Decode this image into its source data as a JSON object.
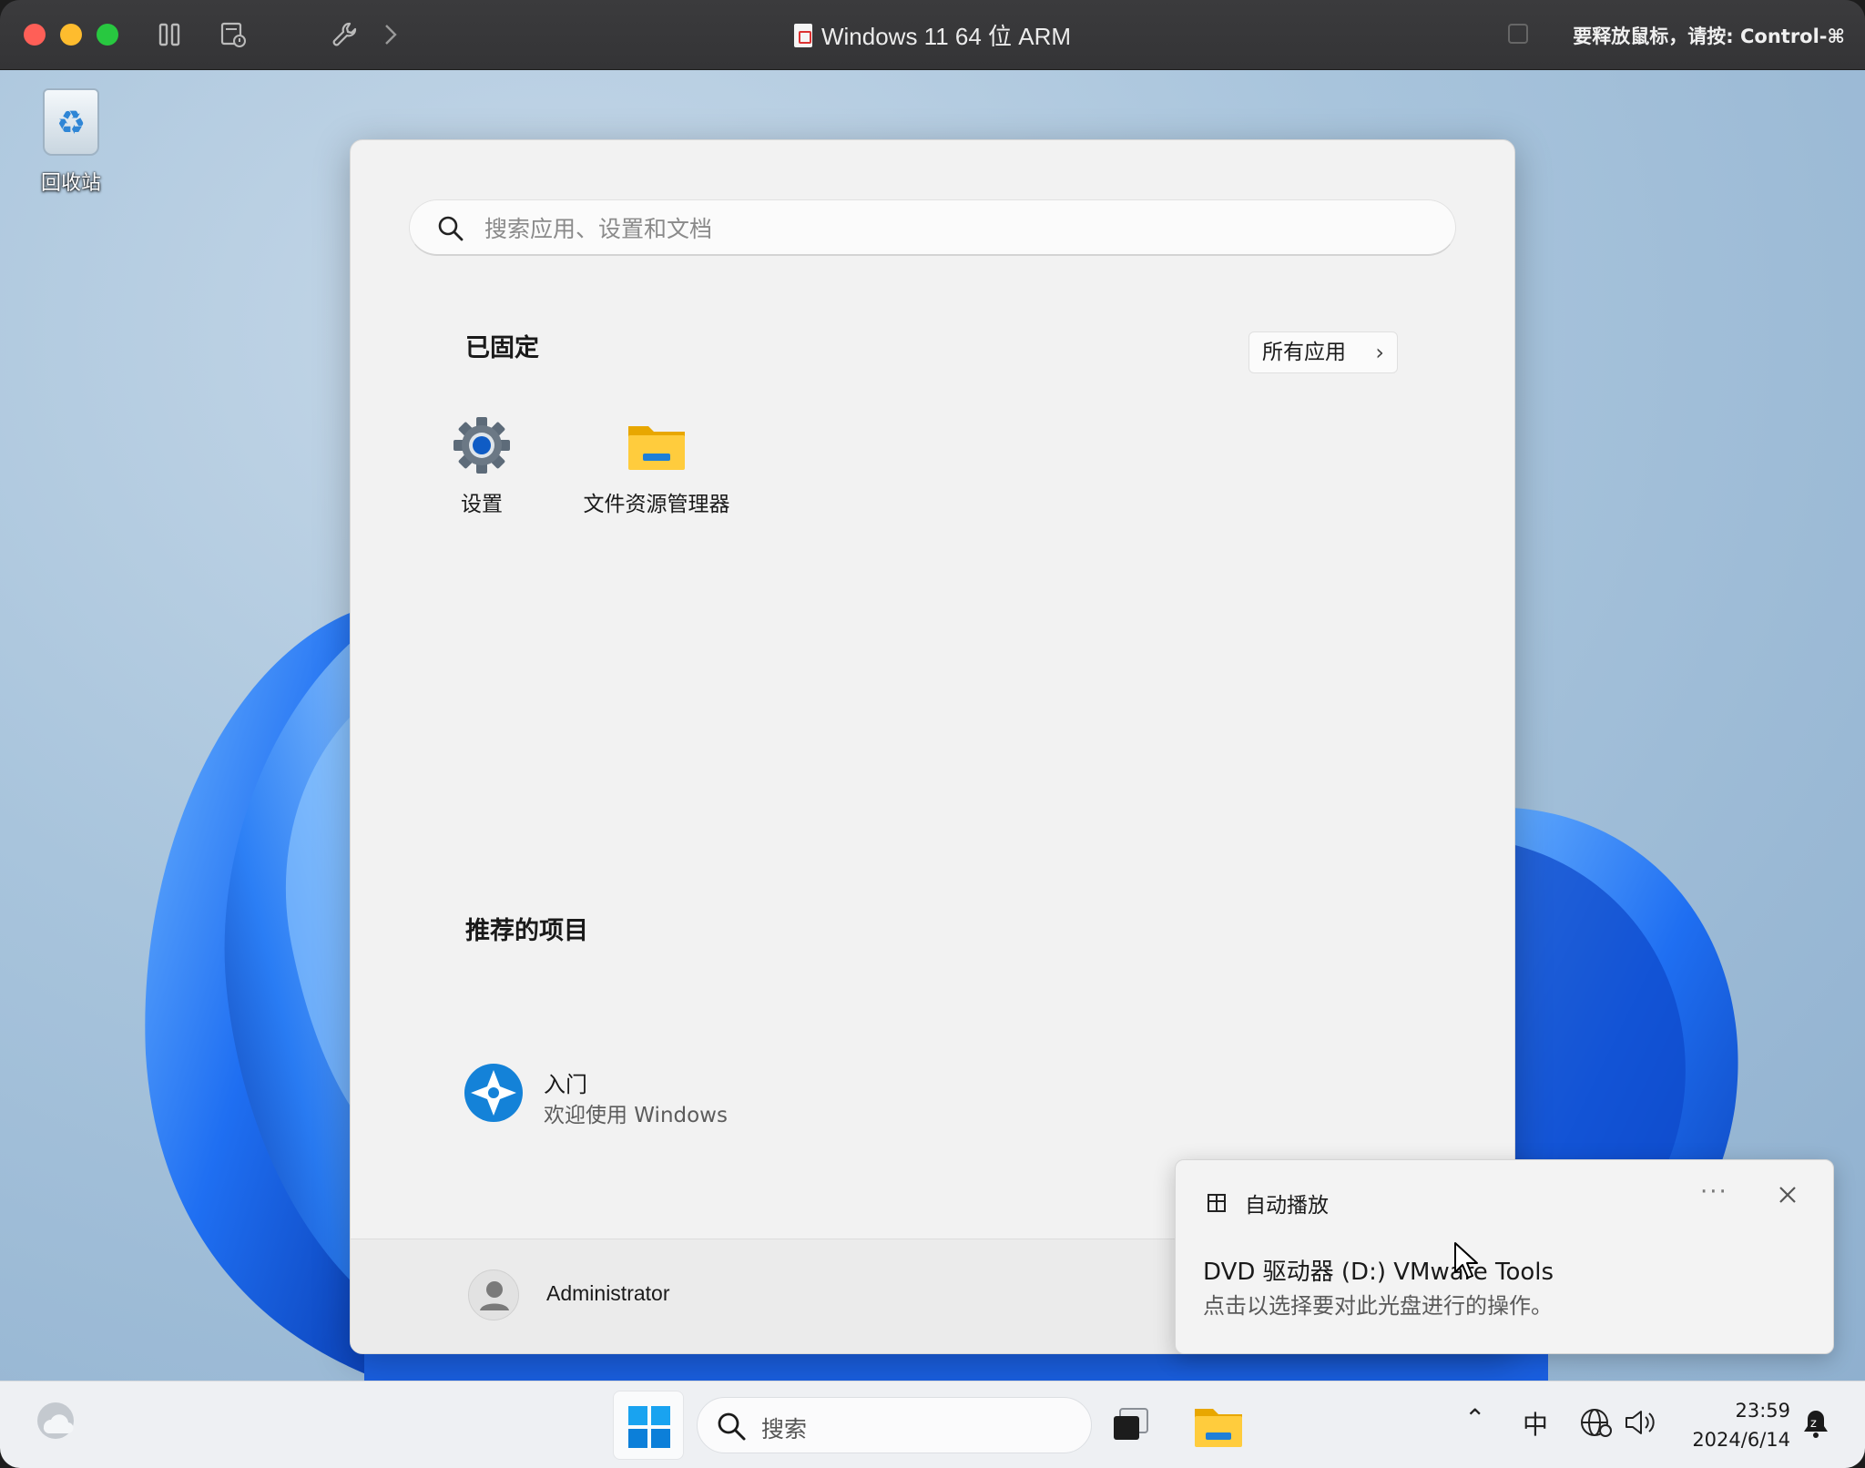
{
  "window": {
    "title": "Windows 11 64 位 ARM",
    "release_hint": "要释放鼠标，请按: Control-⌘"
  },
  "desktop": {
    "recycle_bin_label": "回收站"
  },
  "start_menu": {
    "search_placeholder": "搜索应用、设置和文档",
    "pinned_title": "已固定",
    "all_apps_label": "所有应用",
    "pinned": [
      {
        "name": "设置",
        "icon": "settings-gear-icon"
      },
      {
        "name": "文件资源管理器",
        "icon": "file-explorer-folder-icon"
      }
    ],
    "recommended_title": "推荐的项目",
    "recommended": [
      {
        "title": "入门",
        "subtitle": "欢迎使用 Windows",
        "icon": "get-started-icon"
      }
    ],
    "user_name": "Administrator"
  },
  "toast": {
    "app_name": "自动播放",
    "more_label": "···",
    "title": "DVD 驱动器 (D:) VMware Tools",
    "body": "点击以选择要对此光盘进行的操作。"
  },
  "taskbar": {
    "search_label": "搜索",
    "ime_label": "中",
    "time": "23:59",
    "date": "2024/6/14"
  },
  "colors": {
    "accent": "#0067c0",
    "wallpaper_blue": "#1f6ff2",
    "mac_titlebar": "#3b3b3d"
  }
}
